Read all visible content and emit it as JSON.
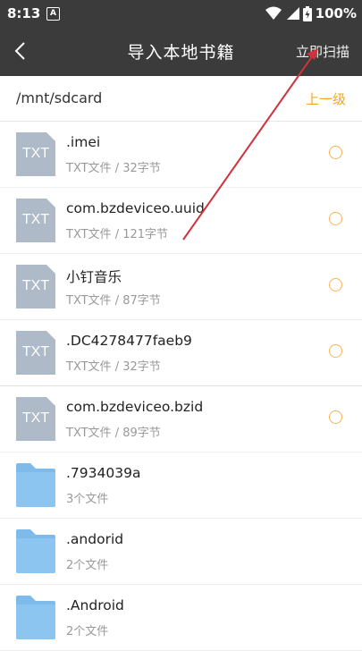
{
  "status": {
    "time": "8:13",
    "notif_letter": "A",
    "battery": "100%"
  },
  "appbar": {
    "title": "导入本地书籍",
    "action": "立即扫描"
  },
  "path": {
    "current": "/mnt/sdcard",
    "up": "上一级"
  },
  "icon_label": "TXT",
  "files": [
    {
      "type": "txt",
      "name": ".imei",
      "meta": "TXT文件 / 32字节"
    },
    {
      "type": "txt",
      "name": "com.bzdeviceo.uuid",
      "meta": "TXT文件 / 121字节"
    },
    {
      "type": "txt",
      "name": "小钉音乐",
      "meta": "TXT文件 / 87字节"
    },
    {
      "type": "txt",
      "name": ".DC4278477faeb9",
      "meta": "TXT文件 / 32字节"
    },
    {
      "type": "txt",
      "name": "com.bzdeviceo.bzid",
      "meta": "TXT文件 / 89字节"
    },
    {
      "type": "folder",
      "name": ".7934039a",
      "meta": "3个文件"
    },
    {
      "type": "folder",
      "name": ".andorid",
      "meta": "2个文件"
    },
    {
      "type": "folder",
      "name": ".Android",
      "meta": "2个文件"
    }
  ],
  "colors": {
    "bar": "#3b3b3b",
    "accent": "#f5a623",
    "folder": "#7fbbea",
    "txt_icon": "#aebac8",
    "annotation": "#d0313a"
  }
}
